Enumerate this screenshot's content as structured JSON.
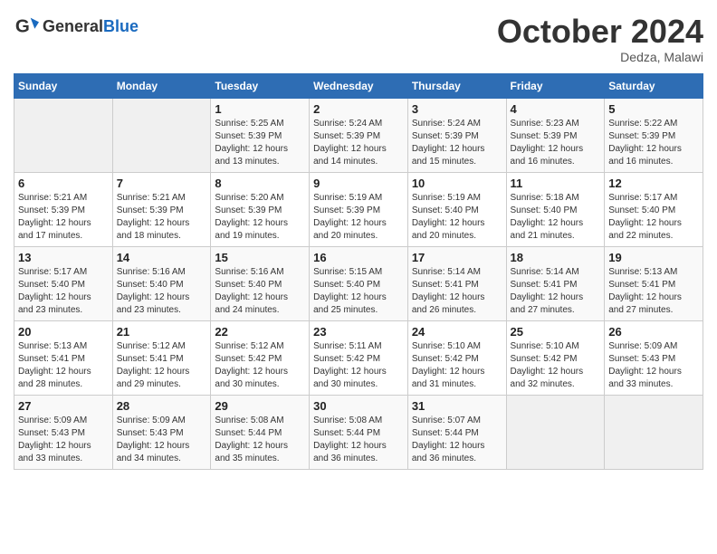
{
  "header": {
    "logo_general": "General",
    "logo_blue": "Blue",
    "month_title": "October 2024",
    "location": "Dedza, Malawi"
  },
  "weekdays": [
    "Sunday",
    "Monday",
    "Tuesday",
    "Wednesday",
    "Thursday",
    "Friday",
    "Saturday"
  ],
  "weeks": [
    [
      {
        "day": "",
        "sunrise": "",
        "sunset": "",
        "daylight": ""
      },
      {
        "day": "",
        "sunrise": "",
        "sunset": "",
        "daylight": ""
      },
      {
        "day": "1",
        "sunrise": "Sunrise: 5:25 AM",
        "sunset": "Sunset: 5:39 PM",
        "daylight": "Daylight: 12 hours and 13 minutes."
      },
      {
        "day": "2",
        "sunrise": "Sunrise: 5:24 AM",
        "sunset": "Sunset: 5:39 PM",
        "daylight": "Daylight: 12 hours and 14 minutes."
      },
      {
        "day": "3",
        "sunrise": "Sunrise: 5:24 AM",
        "sunset": "Sunset: 5:39 PM",
        "daylight": "Daylight: 12 hours and 15 minutes."
      },
      {
        "day": "4",
        "sunrise": "Sunrise: 5:23 AM",
        "sunset": "Sunset: 5:39 PM",
        "daylight": "Daylight: 12 hours and 16 minutes."
      },
      {
        "day": "5",
        "sunrise": "Sunrise: 5:22 AM",
        "sunset": "Sunset: 5:39 PM",
        "daylight": "Daylight: 12 hours and 16 minutes."
      }
    ],
    [
      {
        "day": "6",
        "sunrise": "Sunrise: 5:21 AM",
        "sunset": "Sunset: 5:39 PM",
        "daylight": "Daylight: 12 hours and 17 minutes."
      },
      {
        "day": "7",
        "sunrise": "Sunrise: 5:21 AM",
        "sunset": "Sunset: 5:39 PM",
        "daylight": "Daylight: 12 hours and 18 minutes."
      },
      {
        "day": "8",
        "sunrise": "Sunrise: 5:20 AM",
        "sunset": "Sunset: 5:39 PM",
        "daylight": "Daylight: 12 hours and 19 minutes."
      },
      {
        "day": "9",
        "sunrise": "Sunrise: 5:19 AM",
        "sunset": "Sunset: 5:39 PM",
        "daylight": "Daylight: 12 hours and 20 minutes."
      },
      {
        "day": "10",
        "sunrise": "Sunrise: 5:19 AM",
        "sunset": "Sunset: 5:40 PM",
        "daylight": "Daylight: 12 hours and 20 minutes."
      },
      {
        "day": "11",
        "sunrise": "Sunrise: 5:18 AM",
        "sunset": "Sunset: 5:40 PM",
        "daylight": "Daylight: 12 hours and 21 minutes."
      },
      {
        "day": "12",
        "sunrise": "Sunrise: 5:17 AM",
        "sunset": "Sunset: 5:40 PM",
        "daylight": "Daylight: 12 hours and 22 minutes."
      }
    ],
    [
      {
        "day": "13",
        "sunrise": "Sunrise: 5:17 AM",
        "sunset": "Sunset: 5:40 PM",
        "daylight": "Daylight: 12 hours and 23 minutes."
      },
      {
        "day": "14",
        "sunrise": "Sunrise: 5:16 AM",
        "sunset": "Sunset: 5:40 PM",
        "daylight": "Daylight: 12 hours and 23 minutes."
      },
      {
        "day": "15",
        "sunrise": "Sunrise: 5:16 AM",
        "sunset": "Sunset: 5:40 PM",
        "daylight": "Daylight: 12 hours and 24 minutes."
      },
      {
        "day": "16",
        "sunrise": "Sunrise: 5:15 AM",
        "sunset": "Sunset: 5:40 PM",
        "daylight": "Daylight: 12 hours and 25 minutes."
      },
      {
        "day": "17",
        "sunrise": "Sunrise: 5:14 AM",
        "sunset": "Sunset: 5:41 PM",
        "daylight": "Daylight: 12 hours and 26 minutes."
      },
      {
        "day": "18",
        "sunrise": "Sunrise: 5:14 AM",
        "sunset": "Sunset: 5:41 PM",
        "daylight": "Daylight: 12 hours and 27 minutes."
      },
      {
        "day": "19",
        "sunrise": "Sunrise: 5:13 AM",
        "sunset": "Sunset: 5:41 PM",
        "daylight": "Daylight: 12 hours and 27 minutes."
      }
    ],
    [
      {
        "day": "20",
        "sunrise": "Sunrise: 5:13 AM",
        "sunset": "Sunset: 5:41 PM",
        "daylight": "Daylight: 12 hours and 28 minutes."
      },
      {
        "day": "21",
        "sunrise": "Sunrise: 5:12 AM",
        "sunset": "Sunset: 5:41 PM",
        "daylight": "Daylight: 12 hours and 29 minutes."
      },
      {
        "day": "22",
        "sunrise": "Sunrise: 5:12 AM",
        "sunset": "Sunset: 5:42 PM",
        "daylight": "Daylight: 12 hours and 30 minutes."
      },
      {
        "day": "23",
        "sunrise": "Sunrise: 5:11 AM",
        "sunset": "Sunset: 5:42 PM",
        "daylight": "Daylight: 12 hours and 30 minutes."
      },
      {
        "day": "24",
        "sunrise": "Sunrise: 5:10 AM",
        "sunset": "Sunset: 5:42 PM",
        "daylight": "Daylight: 12 hours and 31 minutes."
      },
      {
        "day": "25",
        "sunrise": "Sunrise: 5:10 AM",
        "sunset": "Sunset: 5:42 PM",
        "daylight": "Daylight: 12 hours and 32 minutes."
      },
      {
        "day": "26",
        "sunrise": "Sunrise: 5:09 AM",
        "sunset": "Sunset: 5:43 PM",
        "daylight": "Daylight: 12 hours and 33 minutes."
      }
    ],
    [
      {
        "day": "27",
        "sunrise": "Sunrise: 5:09 AM",
        "sunset": "Sunset: 5:43 PM",
        "daylight": "Daylight: 12 hours and 33 minutes."
      },
      {
        "day": "28",
        "sunrise": "Sunrise: 5:09 AM",
        "sunset": "Sunset: 5:43 PM",
        "daylight": "Daylight: 12 hours and 34 minutes."
      },
      {
        "day": "29",
        "sunrise": "Sunrise: 5:08 AM",
        "sunset": "Sunset: 5:44 PM",
        "daylight": "Daylight: 12 hours and 35 minutes."
      },
      {
        "day": "30",
        "sunrise": "Sunrise: 5:08 AM",
        "sunset": "Sunset: 5:44 PM",
        "daylight": "Daylight: 12 hours and 36 minutes."
      },
      {
        "day": "31",
        "sunrise": "Sunrise: 5:07 AM",
        "sunset": "Sunset: 5:44 PM",
        "daylight": "Daylight: 12 hours and 36 minutes."
      },
      {
        "day": "",
        "sunrise": "",
        "sunset": "",
        "daylight": ""
      },
      {
        "day": "",
        "sunrise": "",
        "sunset": "",
        "daylight": ""
      }
    ]
  ]
}
